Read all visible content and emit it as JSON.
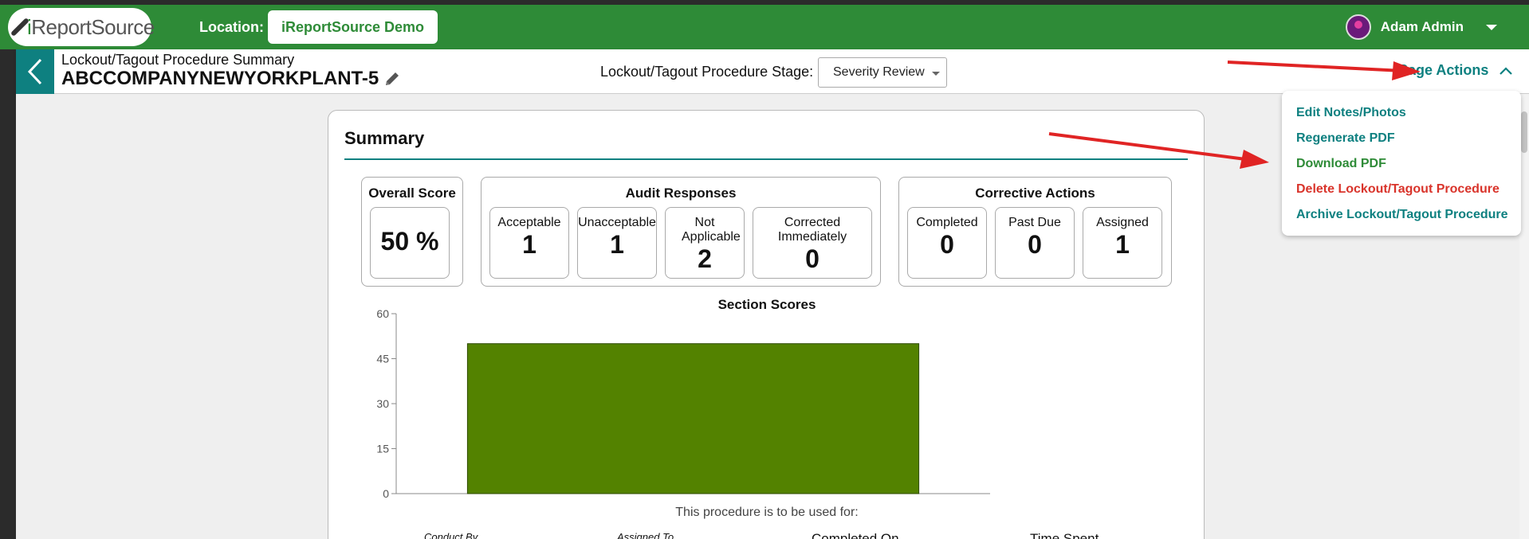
{
  "header": {
    "logo_text_a": "i",
    "logo_text_b": "Report",
    "logo_text_c": "Source",
    "location_label": "Location:",
    "location_value": "iReportSource Demo",
    "user_name": "Adam Admin"
  },
  "subheader": {
    "title_small": "Lockout/Tagout Procedure Summary",
    "title_big": "ABCCOMPANYNEWYORKPLANT-5",
    "stage_label": "Lockout/Tagout Procedure Stage:",
    "stage_value": "Severity Review",
    "page_actions": "Page Actions"
  },
  "page_actions_menu": [
    {
      "label": "Edit Notes/Photos",
      "color": "#0e8080"
    },
    {
      "label": "Regenerate PDF",
      "color": "#0e8080"
    },
    {
      "label": "Download PDF",
      "color": "#2e8b37"
    },
    {
      "label": "Delete Lockout/Tagout Procedure",
      "color": "#d9342b"
    },
    {
      "label": "Archive Lockout/Tagout Procedure",
      "color": "#0e8080"
    }
  ],
  "summary": {
    "title": "Summary",
    "overall": {
      "title": "Overall Score",
      "value": "50 %"
    },
    "audit": {
      "title": "Audit Responses",
      "tiles": [
        {
          "label": "Acceptable",
          "value": "1"
        },
        {
          "label": "Unacceptable",
          "value": "1"
        },
        {
          "label": "Not Applicable",
          "value": "2"
        },
        {
          "label": "Corrected Immediately",
          "value": "0"
        }
      ]
    },
    "corrective": {
      "title": "Corrective Actions",
      "tiles": [
        {
          "label": "Completed",
          "value": "0"
        },
        {
          "label": "Past Due",
          "value": "0"
        },
        {
          "label": "Assigned",
          "value": "1"
        }
      ]
    },
    "note": "This procedure is to be used for:",
    "bottom": {
      "conducted_by": "Conduct By",
      "assigned_to": "Assigned To",
      "completed_on": "Completed On",
      "time_spent": "Time Spent"
    }
  },
  "chart_data": {
    "type": "bar",
    "title": "Section Scores",
    "categories": [
      ""
    ],
    "values": [
      50
    ],
    "ylim": [
      0,
      60
    ],
    "yticks": [
      0,
      15,
      30,
      45,
      60
    ],
    "bar_color": "#538200",
    "xlabel": "",
    "ylabel": ""
  }
}
